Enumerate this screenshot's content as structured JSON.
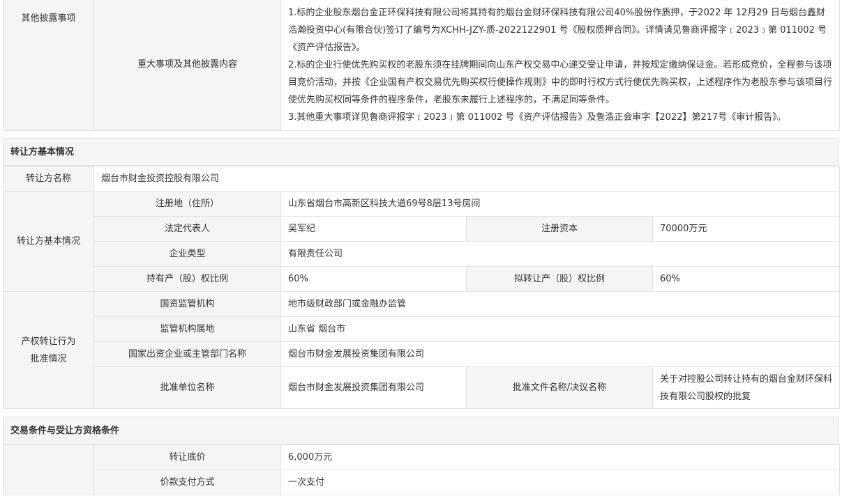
{
  "disclosure": {
    "outer_label": "其他披露事项",
    "inner_label": "重大事项及其他披露内容",
    "lines": [
      "1.标的企业股东烟台金正环保科技有限公司将其持有的烟台金财环保科技有限公司40%股份作质押，于2022 年 12月29 日与烟台鑫财浩瀚投资中心(有限合伙)签订了编号为XCHH-JZY-质-2022122901 号《股权质押合同》。详情请见鲁商评报字﹝2023﹞第 011002 号《资产评估报告》。",
      "2.标的企业行使优先购买权的老股东须在挂牌期间向山东产权交易中心递交受让申请，并按规定缴纳保证金。若形成竞价，全程参与该项目竞价活动，并按《企业国有产权交易优先购买权行使操作规则》中的即时行权方式行使优先购买权，上述程序作为老股东参与该项目行使优先购买权同等条件的程序条件，老股东未履行上述程序的，不满足同等条件。",
      "3.其他重大事项详见鲁商评报字﹝2023﹞第 011002 号《资产评估报告》及鲁浩正会审字【2022】第217号《审计报告》。"
    ]
  },
  "transferor_section": {
    "title": "转让方基本情况",
    "name_label": "转让方名称",
    "name_value": "烟台市财金投资控股有限公司",
    "basic_label": "转让方基本情况",
    "address_label": "注册地（住所）",
    "address_value": "山东省烟台市高新区科技大道69号8层13号房间",
    "legal_rep_label": "法定代表人",
    "legal_rep_value": "吴军纪",
    "capital_label": "注册资本",
    "capital_value": "70000万元",
    "type_label": "企业类型",
    "type_value": "有限责任公司",
    "held_ratio_label": "持有产（股）权比例",
    "held_ratio_value": "60%",
    "transfer_ratio_label": "拟转让产（股）权比例",
    "transfer_ratio_value": "60%",
    "approval_label": "产权转让行为批准情况",
    "supervisor_label": "国资监管机构",
    "supervisor_value": "地市级财政部门或金融办监管",
    "supervisor_location_label": "监管机构属地",
    "supervisor_location_value": "山东省 烟台市",
    "state_enterprise_label": "国家出资企业或主管部门名称",
    "state_enterprise_value": "烟台市财金发展投资集团有限公司",
    "approver_label": "批准单位名称",
    "approver_value": "烟台市财金发展投资集团有限公司",
    "approval_doc_label": "批准文件名称/决议名称",
    "approval_doc_value": "关于对控股公司转让持有的烟台金财环保科技有限公司股权的批复"
  },
  "trade_section": {
    "title": "交易条件与受让方资格条件",
    "price_label": "转让底价",
    "price_value": "6,000万元",
    "payment_label": "价款支付方式",
    "payment_value": "一次支付"
  }
}
